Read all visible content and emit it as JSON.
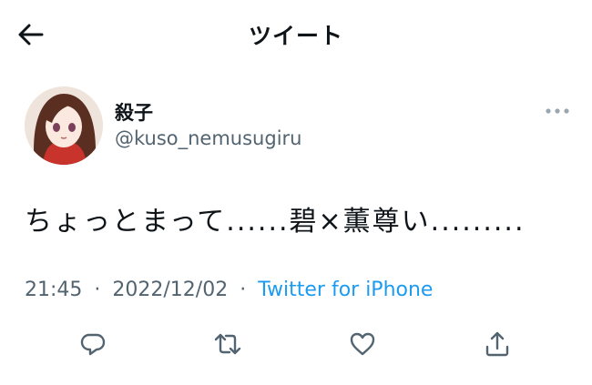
{
  "header": {
    "title": "ツイート",
    "back_icon": "arrow-left-icon"
  },
  "tweet": {
    "author": {
      "display_name": "殺子",
      "handle": "@kuso_nemusugiru",
      "avatar": "avatar-illustration"
    },
    "more_icon": "ellipsis-icon",
    "text": "ちょっとまって......碧×薫尊い.........",
    "time": "21:45",
    "date": "2022/12/02",
    "separator": "·",
    "source": "Twitter for iPhone"
  },
  "actions": [
    {
      "icon": "reply-icon"
    },
    {
      "icon": "retweet-icon"
    },
    {
      "icon": "like-icon"
    },
    {
      "icon": "share-icon"
    }
  ],
  "colors": {
    "text": "#0f1419",
    "secondary": "#536471",
    "link": "#1d9bf0"
  }
}
